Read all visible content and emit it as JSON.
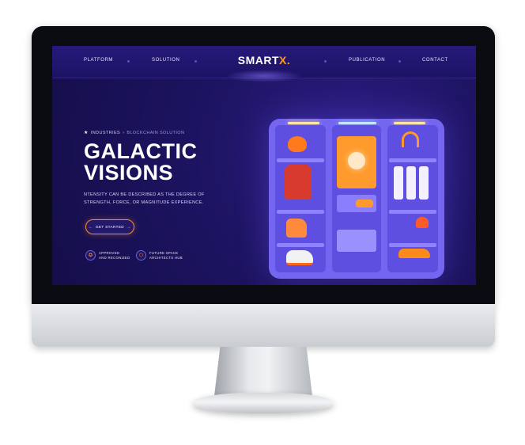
{
  "nav": {
    "items_left": [
      "PLATFORM",
      "SOLUTION"
    ],
    "items_right": [
      "PUBLICATION",
      "CONTACT"
    ],
    "logo_main": "SMART",
    "logo_accent": "X."
  },
  "hero": {
    "breadcrumb_1": "INDUSTRIES",
    "breadcrumb_sep": "›",
    "breadcrumb_2": "BLOCKCHAIN SOLUTION",
    "title_line1": "GALACTIC",
    "title_line2": "VISIONS",
    "description": "NTENSITY CAN BE DESCRIBED AS THE DEGREE OF STRENGTH, FORCE, OR MAGNITUDE EXPERIENCE.",
    "cta_label": "GET STARTED"
  },
  "badges": [
    {
      "text": "APPROVED\nAND RECONIZED",
      "icon": "award-icon"
    },
    {
      "text": "FUTURE SPACE\nARCHITECTS HUB",
      "icon": "hub-icon"
    }
  ],
  "colors": {
    "screen_bg": "#1d1462",
    "accent": "#ff9a1a",
    "wardrobe": "#7466f0"
  }
}
